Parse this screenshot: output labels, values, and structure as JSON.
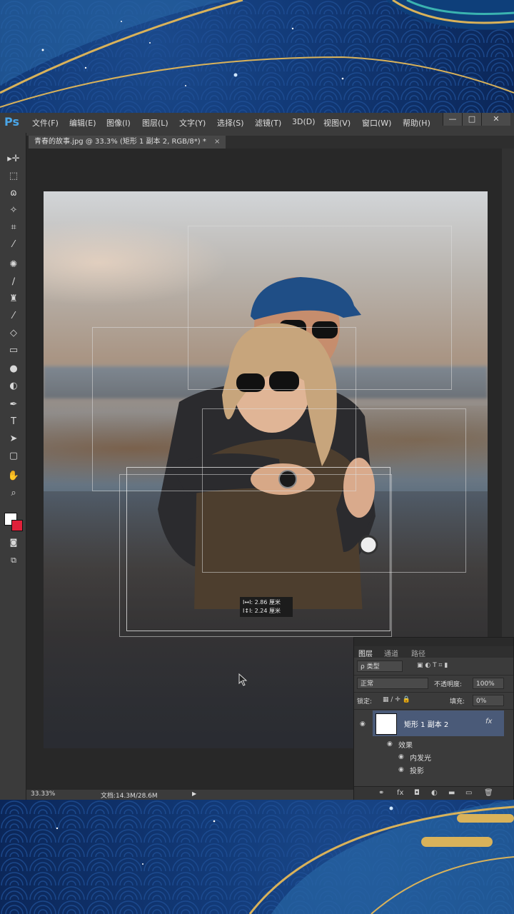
{
  "menubar": {
    "logo": "Ps",
    "items": [
      "文件(F)",
      "编辑(E)",
      "图像(I)",
      "图层(L)",
      "文字(Y)",
      "选择(S)",
      "滤镜(T)",
      "3D(D)",
      "视图(V)",
      "窗口(W)",
      "帮助(H)"
    ],
    "window_buttons": [
      "—",
      "□",
      "✕"
    ]
  },
  "document_tab": {
    "title": "青春的故事.jpg @ 33.3% (矩形 1 副本 2, RGB/8*) *",
    "close": "×"
  },
  "toolbar": {
    "tools": [
      "move-tool",
      "marquee-tool",
      "lasso-tool",
      "magic-wand-tool",
      "crop-tool",
      "eyedropper-tool",
      "healing-brush-tool",
      "brush-tool",
      "clone-stamp-tool",
      "history-brush-tool",
      "eraser-tool",
      "gradient-tool",
      "blur-tool",
      "dodge-tool",
      "pen-tool",
      "type-tool",
      "path-selection-tool",
      "rectangle-tool",
      "hand-tool",
      "zoom-tool"
    ],
    "foreground_color": "#ffffff",
    "background_color": "#e0213a"
  },
  "measure_tooltip": {
    "line1": "I↔I: 2.86 厘米",
    "line2": "I↕I: 2.24 厘米"
  },
  "status": {
    "zoom": "33.33%",
    "doc": "文档:14.3M/28.6M",
    "arrow": "▶"
  },
  "layers_panel": {
    "tabs": [
      "图层",
      "通道",
      "路径"
    ],
    "filter_label": "ρ 类型",
    "blend_mode": "正常",
    "opacity_label": "不透明度:",
    "opacity_value": "100%",
    "lock_label": "锁定:",
    "fill_label": "填充:",
    "fill_value": "0%",
    "layer_name": "矩形 1 副本 2",
    "fx": "fx",
    "effects_label": "效果",
    "effect_1": "内发光",
    "effect_2": "投影"
  },
  "colors": {
    "ps_accent": "#4aa6e8",
    "bg_blue": "#123a78",
    "gold": "#d9b25a",
    "layer_selected": "#4a5a78"
  }
}
